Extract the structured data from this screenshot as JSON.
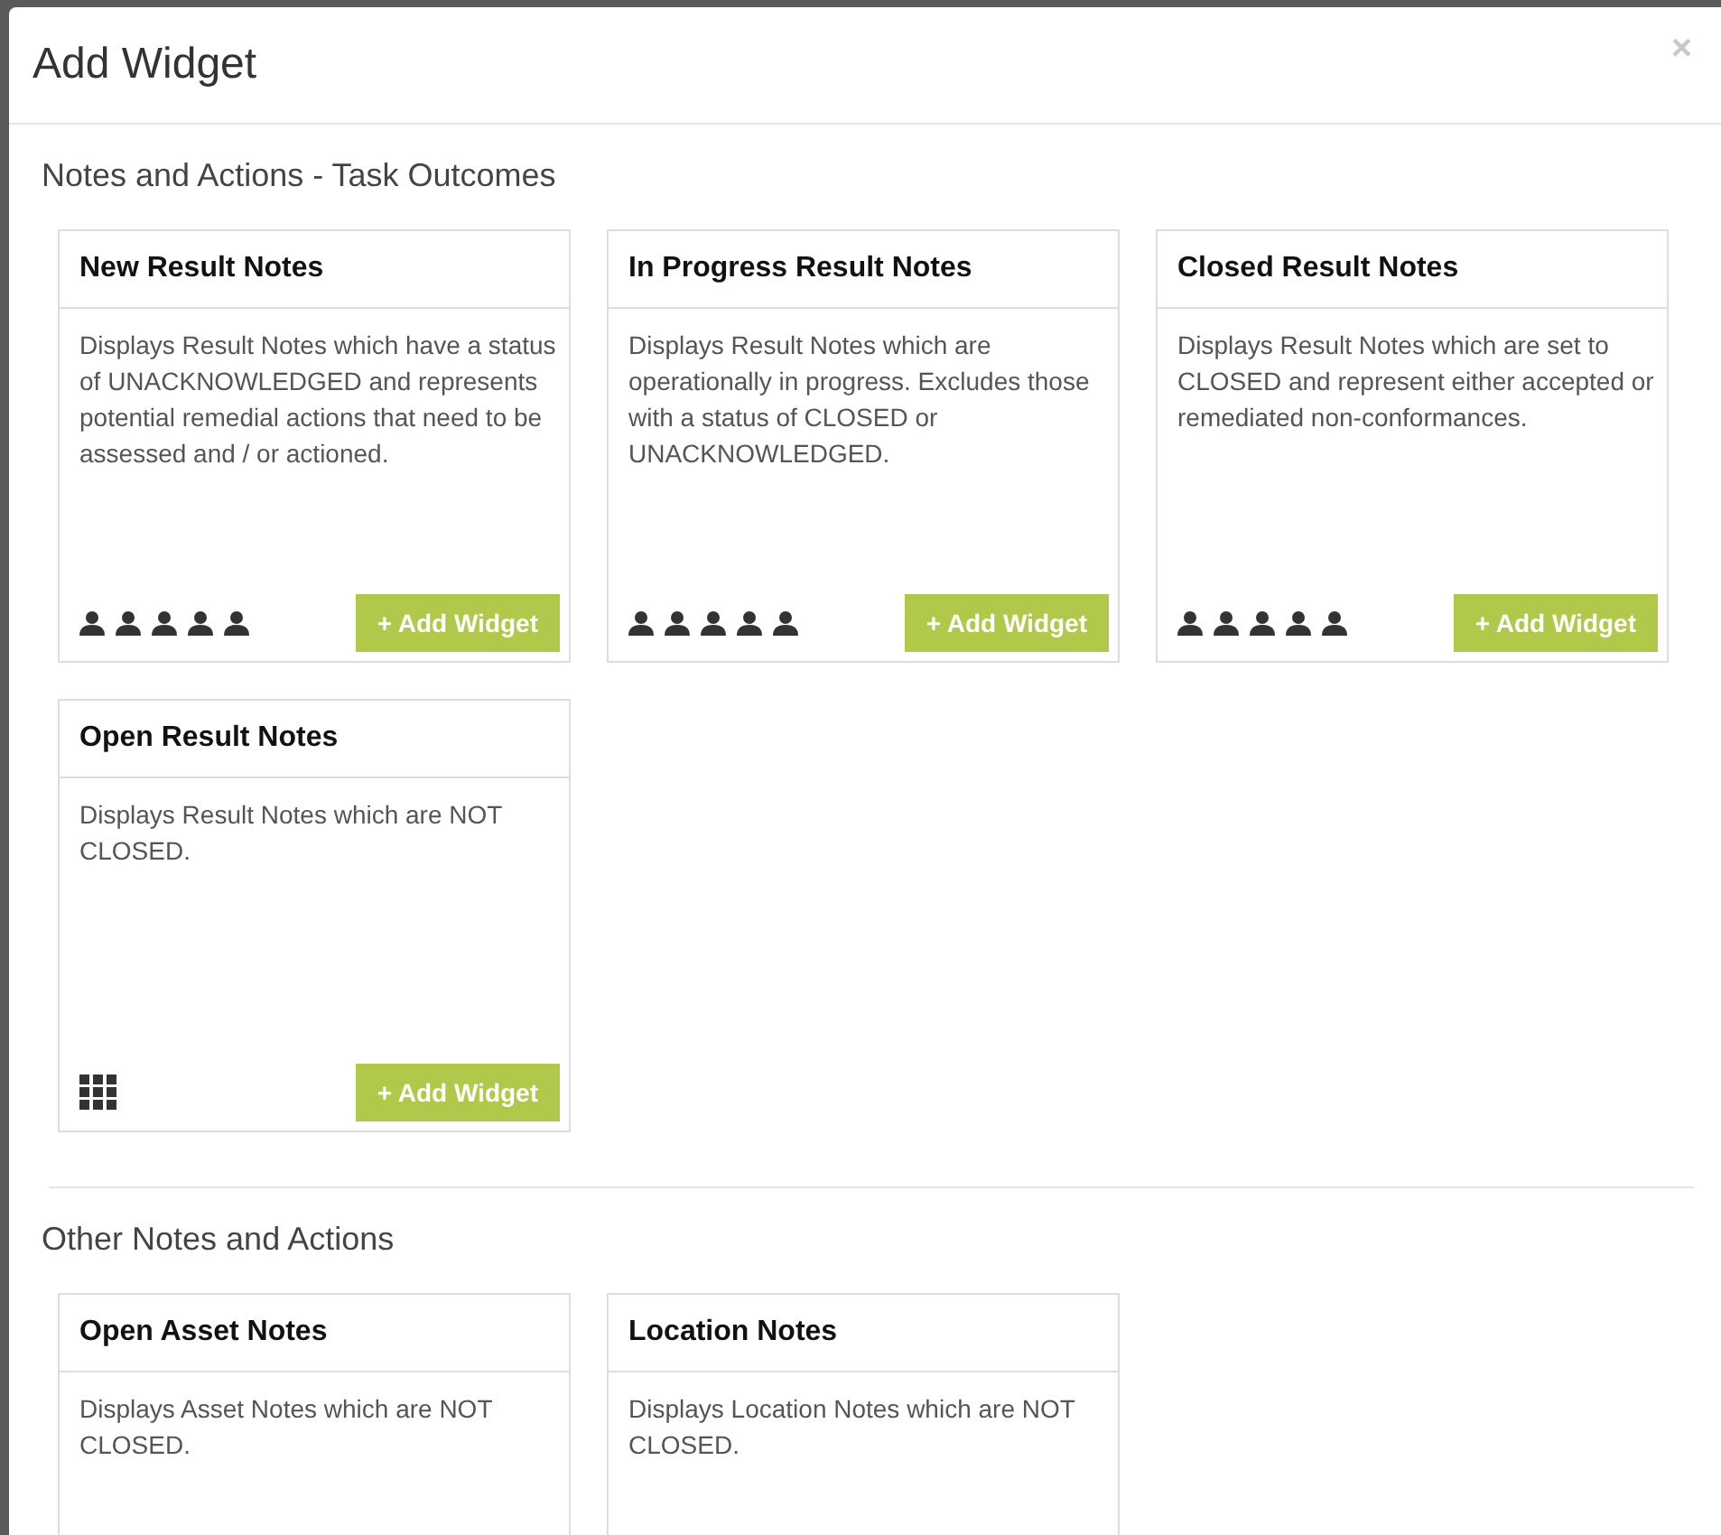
{
  "dialog": {
    "title": "Add Widget",
    "close": "×"
  },
  "sections": [
    {
      "title": "Notes and Actions - Task Outcomes",
      "widgets": [
        {
          "title": "New Result Notes",
          "description": "Displays Result Notes which have a status of UNACKNOWLEDGED and represents potential remedial actions that need to be assessed and / or actioned.",
          "kind": "people",
          "button": "+ Add Widget"
        },
        {
          "title": "In Progress Result Notes",
          "description": "Displays Result Notes which are operationally in progress. Excludes those with a status of CLOSED or UNACKNOWLEDGED.",
          "kind": "people",
          "button": "+ Add Widget"
        },
        {
          "title": "Closed Result Notes",
          "description": "Displays Result Notes which are set to CLOSED and represent either accepted or remediated non-conformances.",
          "kind": "people",
          "button": "+ Add Widget"
        },
        {
          "title": "Open Result Notes",
          "description": "Displays Result Notes which are NOT CLOSED.",
          "kind": "grid",
          "button": "+ Add Widget"
        }
      ]
    },
    {
      "title": "Other Notes and Actions",
      "widgets": [
        {
          "title": "Open Asset Notes",
          "description": "Displays Asset Notes which are NOT CLOSED."
        },
        {
          "title": "Location Notes",
          "description": "Displays Location Notes which are NOT CLOSED."
        }
      ]
    }
  ]
}
